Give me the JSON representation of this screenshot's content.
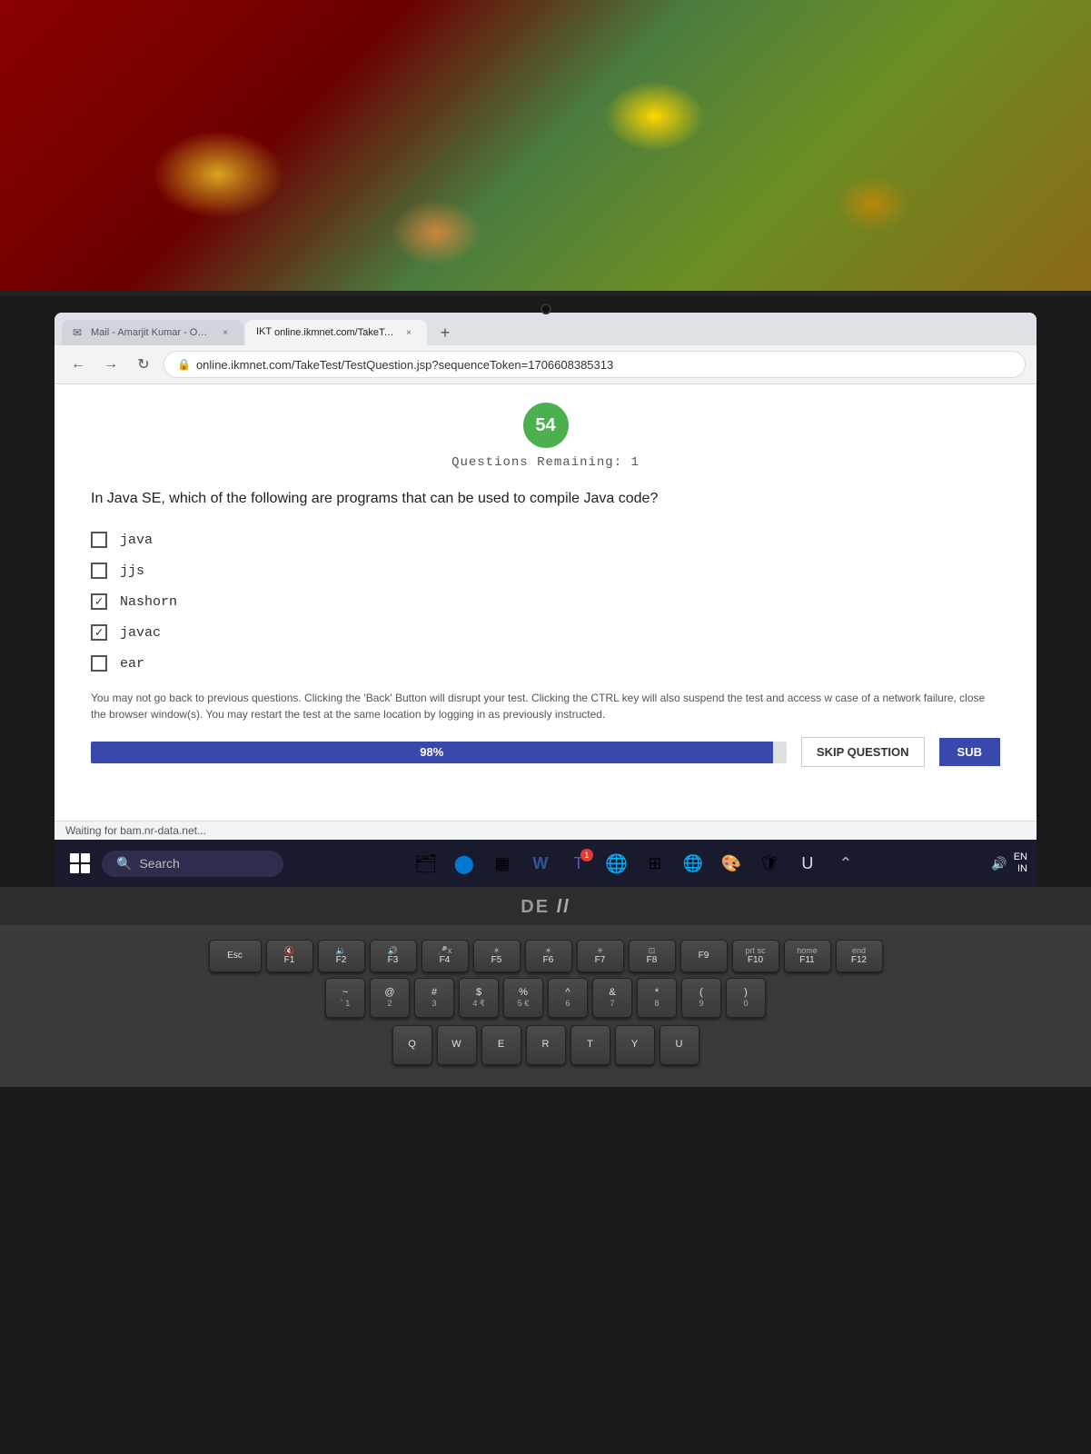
{
  "background": {
    "description": "floral fabric background"
  },
  "browser": {
    "tabs": [
      {
        "label": "Mail - Amarjit Kumar - Outlook",
        "active": false,
        "icon": "mail"
      },
      {
        "label": "ikn online.ikmnet.com/TakeTest/Te...",
        "active": true,
        "icon": "test"
      }
    ],
    "new_tab_label": "+",
    "back_label": "←",
    "forward_label": "→",
    "refresh_label": "↻",
    "address": "online.ikmnet.com/TakeTest/TestQuestion.jsp?sequenceToken=1706608385313",
    "timer": "54",
    "questions_remaining": "Questions Remaining: 1",
    "question_text": "In Java SE, which of the following are programs that can be used to compile Java code?",
    "options": [
      {
        "label": "java",
        "checked": false
      },
      {
        "label": "jjs",
        "checked": false
      },
      {
        "label": "Nashorn",
        "checked": true
      },
      {
        "label": "javac",
        "checked": true
      },
      {
        "label": "ear",
        "checked": false
      }
    ],
    "warning_text": "You may not go back to previous questions. Clicking the 'Back' Button will disrupt your test. Clicking the CTRL key will also suspend the test and access w case of a network failure, close the browser window(s). You may restart the test at the same location by logging in as previously instructed.",
    "progress_percent": "98%",
    "skip_button_label": "SKIP QUESTION",
    "submit_button_label": "SUB",
    "status_bar_text": "Waiting for bam.nr-data.net..."
  },
  "taskbar": {
    "search_placeholder": "Search",
    "system_lang_line1": "EN",
    "system_lang_line2": "IN"
  },
  "dell_logo": "DE",
  "keyboard": {
    "fn_row": [
      "Esc",
      "F1",
      "F2",
      "F3",
      "F4",
      "F5",
      "F6",
      "F7",
      "F8",
      "F9",
      "F10",
      "F11",
      "F12"
    ],
    "row1": [
      "~\n1",
      "@\n2",
      "#\n3",
      "$\n4 ₹",
      "%\n5 €",
      "^\n6",
      "&\n7",
      "*\n8",
      "(\n9",
      ")\n0"
    ],
    "row2": [
      "Q",
      "W",
      "E",
      "R",
      "T",
      "Y",
      "U"
    ],
    "icons": {
      "windows": "⊞",
      "search": "🔍",
      "folder": "📁",
      "edge": "🌐",
      "calendar": "📅",
      "teams": "👥",
      "chrome": "⬤",
      "grid": "⊞",
      "globe": "🌐",
      "paint": "🎨",
      "shield": "🛡",
      "up_arrow": "⌃"
    }
  }
}
